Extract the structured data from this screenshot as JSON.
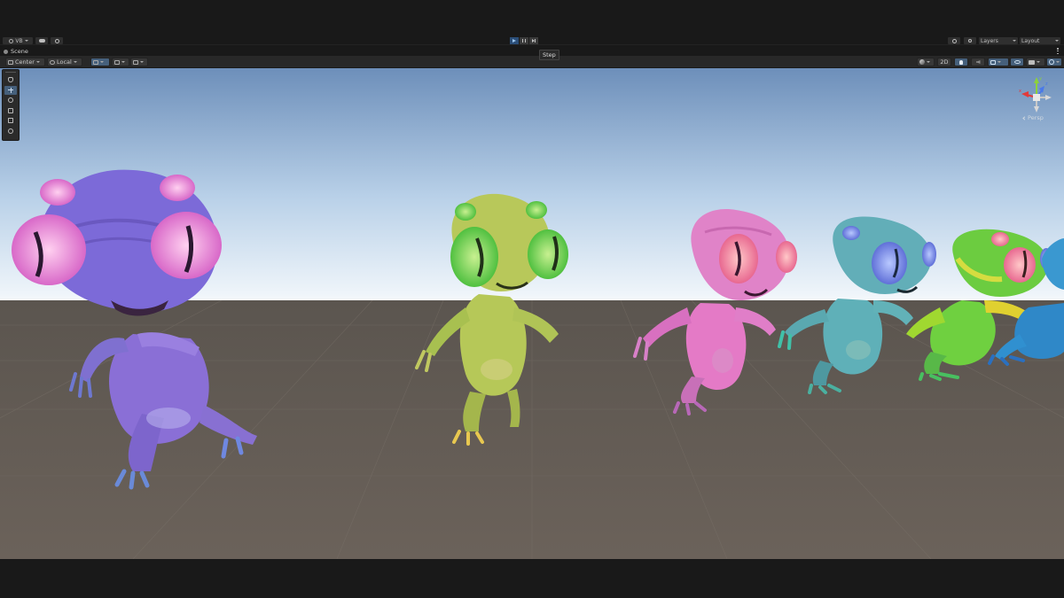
{
  "main_toolbar": {
    "account_label": "VB",
    "play_icon": "play-icon",
    "pause_icon": "pause-icon",
    "step_icon": "step-icon",
    "layers_label": "Layers",
    "layout_label": "Layout"
  },
  "tooltip": {
    "text": "Step"
  },
  "scene_tab": {
    "label": "Scene"
  },
  "scene_toolbar": {
    "pivot_label": "Center",
    "space_label": "Local",
    "mode_2d_label": "2D"
  },
  "gizmo": {
    "projection_label": "Persp",
    "axis_y_label": "y",
    "axis_x_label": "x",
    "axis_z_label": "z"
  },
  "colors": {
    "editor_bg": "#191919",
    "toolbar_bg": "#282828",
    "active_button": "#46607c",
    "sky_top": "#6d8fba",
    "horizon": "#f2f7fb",
    "ground": "#6b625a",
    "creature_purple": "#8a6fd6",
    "creature_yellow_green": "#b6c858",
    "creature_pink": "#e47ac6",
    "creature_teal": "#5fb0b8",
    "creature_green": "#6fd040"
  }
}
